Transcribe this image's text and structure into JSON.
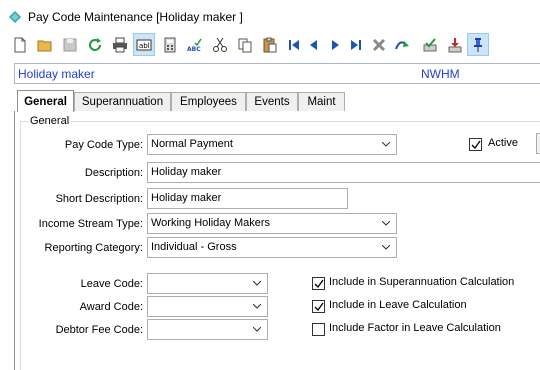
{
  "window": {
    "title": "Pay Code Maintenance  [Holiday maker ]"
  },
  "toolbar": {
    "buttons": [
      {
        "icon": "new-document-icon"
      },
      {
        "icon": "open-folder-icon"
      },
      {
        "icon": "save-icon"
      },
      {
        "icon": "refresh-icon"
      },
      {
        "icon": "print-icon"
      },
      {
        "icon": "text-field-icon"
      },
      {
        "icon": "calculator-icon"
      },
      {
        "icon": "spell-check-icon"
      },
      {
        "icon": "cut-icon"
      },
      {
        "icon": "copy-icon"
      },
      {
        "icon": "paste-icon"
      },
      {
        "icon": "first-record-icon"
      },
      {
        "icon": "previous-record-icon"
      },
      {
        "icon": "next-record-icon"
      },
      {
        "icon": "last-record-icon"
      },
      {
        "icon": "delete-icon"
      },
      {
        "icon": "jump-icon"
      },
      {
        "icon": "approve-icon"
      },
      {
        "icon": "download-icon"
      },
      {
        "icon": "pin-icon"
      }
    ]
  },
  "header": {
    "name": "Holiday maker",
    "code": "NWHM"
  },
  "tabs": [
    {
      "label": "General",
      "active": true
    },
    {
      "label": "Superannuation",
      "active": false
    },
    {
      "label": "Employees",
      "active": false
    },
    {
      "label": "Events",
      "active": false
    },
    {
      "label": "Maint",
      "active": false
    }
  ],
  "group": {
    "label": "General"
  },
  "form": {
    "pay_code_type": {
      "label": "Pay Code Type:",
      "value": "Normal Payment"
    },
    "active": {
      "label": "Active",
      "checked": true
    },
    "description": {
      "label": "Description:",
      "value": "Holiday maker"
    },
    "short_description": {
      "label": "Short Description:",
      "value": "Holiday maker"
    },
    "income_stream_type": {
      "label": "Income Stream Type:",
      "value": "Working Holiday Makers"
    },
    "reporting_category": {
      "label": "Reporting Category:",
      "value": "Individual - Gross"
    },
    "leave_code": {
      "label": "Leave Code:",
      "value": ""
    },
    "award_code": {
      "label": "Award Code:",
      "value": ""
    },
    "debtor_fee_code": {
      "label": "Debtor Fee Code:",
      "value": ""
    },
    "include_super": {
      "label": "Include in Superannuation Calculation",
      "checked": true
    },
    "include_leave": {
      "label": "Include in Leave Calculation",
      "checked": true
    },
    "include_factor": {
      "label": "Include Factor in Leave Calculation",
      "checked": false
    }
  },
  "colors": {
    "accent_text": "#1f3fd1",
    "pressed_button": "#cce4f7"
  }
}
